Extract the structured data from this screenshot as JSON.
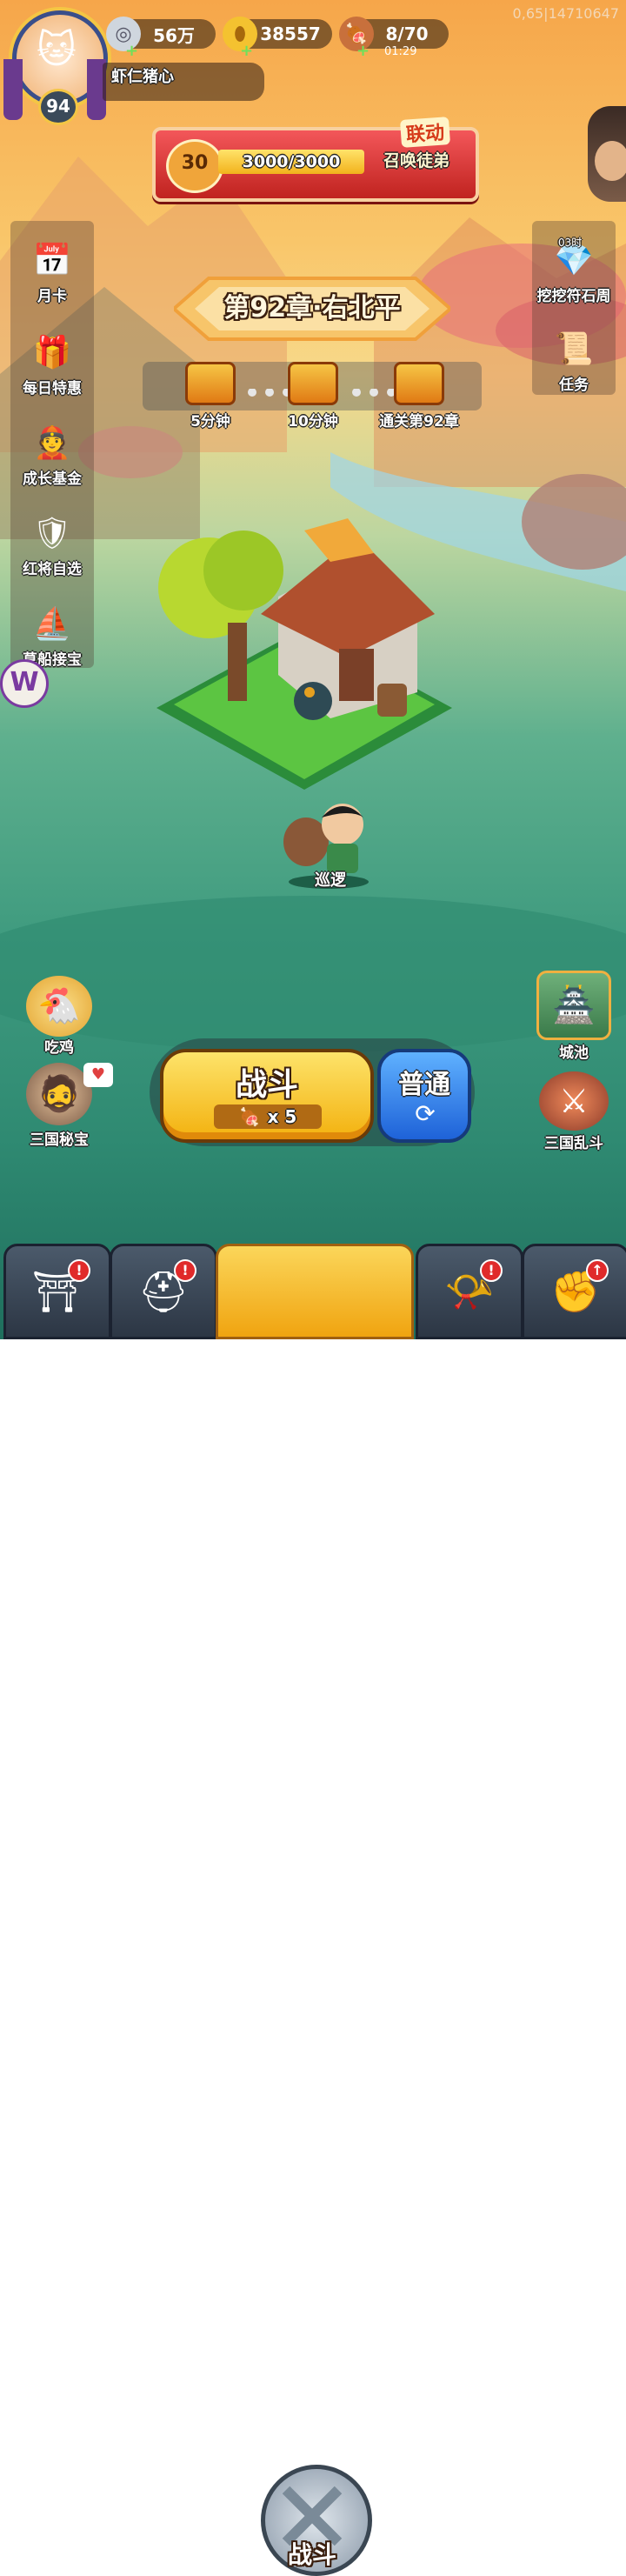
{
  "debug_text": "0,65|14710647",
  "player": {
    "level": "94",
    "name": "虾仁猪心"
  },
  "resources": {
    "silver": "56万",
    "gold": "38557",
    "stamina": "8/70",
    "stamina_timer": "01:29"
  },
  "event_banner": {
    "tag": "联动",
    "level": "30",
    "progress_text": "3000/3000",
    "progress": 1.0,
    "action": "召唤徒弟"
  },
  "left_menu": [
    {
      "label": "月卡",
      "icon": "calendar-card-icon"
    },
    {
      "label": "每日特惠",
      "icon": "gift-bag-icon"
    },
    {
      "label": "成长基金",
      "icon": "fortune-god-icon"
    },
    {
      "label": "红将自选",
      "icon": "red-general-icon"
    },
    {
      "label": "草船接宝",
      "icon": "straw-boat-icon"
    }
  ],
  "right_menu": [
    {
      "label": "挖挖符石周",
      "badge": "03时",
      "icon": "runestone-icon"
    },
    {
      "label": "任务",
      "icon": "scroll-icon"
    }
  ],
  "chapter": {
    "title": "第92章·右北平",
    "chests": [
      {
        "label": "5分钟"
      },
      {
        "label": "10分钟"
      },
      {
        "label": "通关第92章"
      }
    ]
  },
  "patrol_label": "巡逻",
  "bottom_left": [
    {
      "label": "吃鸡"
    },
    {
      "label": "三国秘宝"
    }
  ],
  "bottom_right": [
    {
      "label": "城池"
    },
    {
      "label": "三国乱斗"
    }
  ],
  "battle": {
    "label": "战斗",
    "cost": "x 5",
    "mode": "普通"
  },
  "nav": {
    "center_label": "战斗"
  },
  "colors": {
    "battle_yellow": "#f7c21c",
    "mode_blue": "#2f86e8",
    "banner_red": "#d8322a"
  }
}
